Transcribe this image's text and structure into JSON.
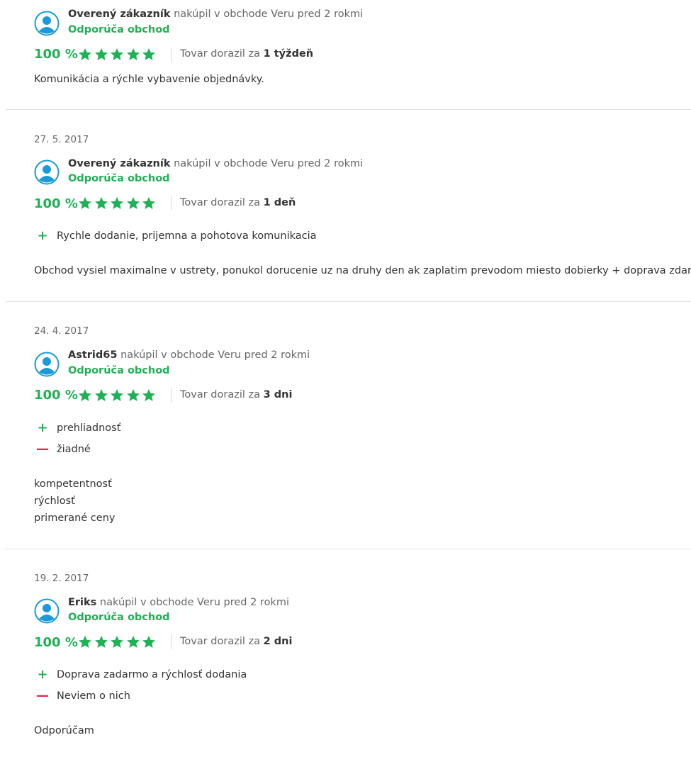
{
  "colors": {
    "accent_green": "#1fb155",
    "negative_red": "#e0284f",
    "avatar_blue": "#1a9ad6"
  },
  "icons": {
    "avatar": "user-avatar-icon",
    "star": "star-icon",
    "pro": "plus-icon",
    "con": "minus-icon"
  },
  "reviews": [
    {
      "date": "",
      "author": "Overený zákazník",
      "purchase_note": "nakúpil v obchode Veru pred 2 rokmi",
      "recommend": "Odporúča obchod",
      "rating_percent": "100 %",
      "stars": 5,
      "delivery_prefix": "Tovar dorazil za",
      "delivery_value": "1 týždeň",
      "pros": [],
      "cons": [],
      "text_lines": [
        "Komunikácia a rýchle vybavenie objednávky."
      ]
    },
    {
      "date": "27. 5. 2017",
      "author": "Overený zákazník",
      "purchase_note": "nakúpil v obchode Veru pred 2 rokmi",
      "recommend": "Odporúča obchod",
      "rating_percent": "100 %",
      "stars": 5,
      "delivery_prefix": "Tovar dorazil za",
      "delivery_value": "1 deň",
      "pros": [
        "Rychle dodanie, prijemna a pohotova komunikacia"
      ],
      "cons": [],
      "text_lines": [
        "Obchod vysiel maximalne v ustrety, ponukol dorucenie uz na druhy den ak zaplatim prevodom miesto dobierky + doprava zdarma"
      ]
    },
    {
      "date": "24. 4. 2017",
      "author": "Astrid65",
      "purchase_note": "nakúpil v obchode Veru pred 2 rokmi",
      "recommend": "Odporúča obchod",
      "rating_percent": "100 %",
      "stars": 5,
      "delivery_prefix": "Tovar dorazil za",
      "delivery_value": "3 dni",
      "pros": [
        "prehliadnosť"
      ],
      "cons": [
        "žiadné"
      ],
      "text_lines": [
        "kompetentnosť",
        "rýchlosť",
        "primerané ceny"
      ]
    },
    {
      "date": "19. 2. 2017",
      "author": "Eriks",
      "purchase_note": "nakúpil v obchode Veru pred 2 rokmi",
      "recommend": "Odporúča obchod",
      "rating_percent": "100 %",
      "stars": 5,
      "delivery_prefix": "Tovar dorazil za",
      "delivery_value": "2 dni",
      "pros": [
        "Doprava zadarmo a rýchlosť dodania"
      ],
      "cons": [
        "Neviem o nich"
      ],
      "text_lines": [
        "Odporúčam"
      ]
    }
  ]
}
